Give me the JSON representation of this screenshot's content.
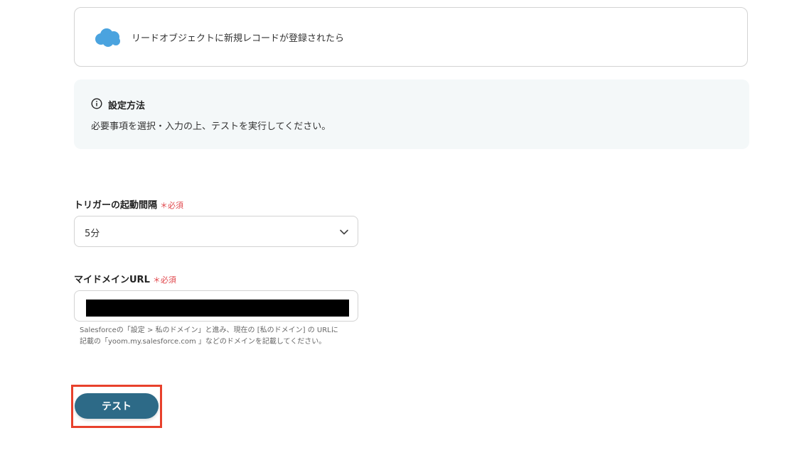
{
  "trigger": {
    "icon": "salesforce-cloud-icon",
    "text": "リードオブジェクトに新規レコードが登録されたら"
  },
  "info": {
    "icon": "info-icon",
    "title": "設定方法",
    "body": "必要事項を選択・入力の上、テストを実行してください。"
  },
  "form": {
    "interval": {
      "label": "トリガーの起動間隔",
      "required": "＊必須",
      "value": "5分"
    },
    "domain_url": {
      "label": "マイドメインURL",
      "required": "＊必須",
      "value": "",
      "help_line1": "Salesforceの「設定 > 私のドメイン」と進み、現在の [私のドメイン] の URLに",
      "help_line2": "記載の「yoom.my.salesforce.com 」などのドメインを記載してください。"
    }
  },
  "actions": {
    "test_label": "テスト"
  },
  "colors": {
    "accent": "#2d6a87",
    "required": "#e0474c",
    "highlight": "#e8412c",
    "salesforce": "#4aa3df"
  }
}
